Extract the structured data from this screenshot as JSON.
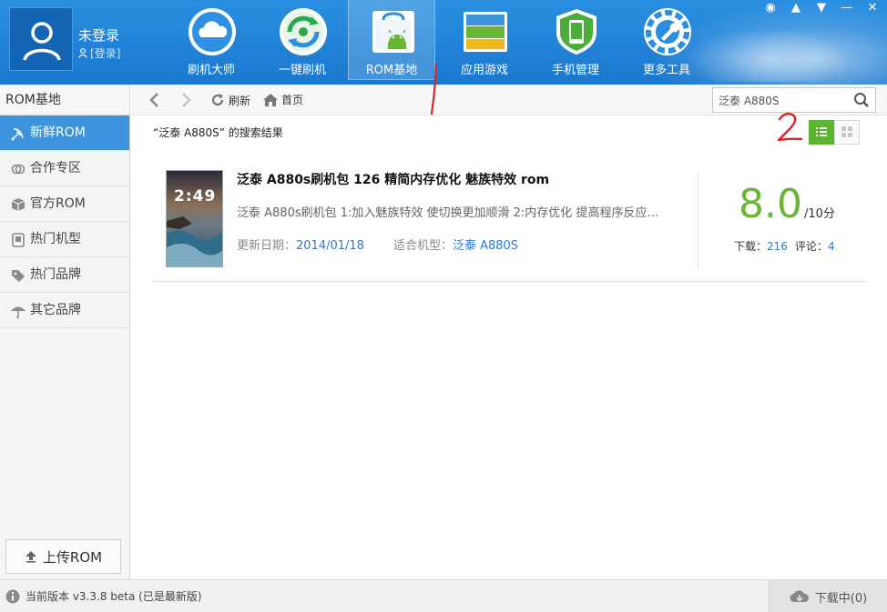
{
  "header": {
    "user": {
      "name": "未登录",
      "login_link": "[登录]"
    },
    "nav": [
      {
        "label": "刷机大师",
        "icon": "cloud-icon"
      },
      {
        "label": "一键刷机",
        "icon": "refresh-disc-icon"
      },
      {
        "label": "ROM基地",
        "icon": "android-bag-icon",
        "active": true
      },
      {
        "label": "应用游戏",
        "icon": "app-stack-icon"
      },
      {
        "label": "手机管理",
        "icon": "phone-shield-icon"
      },
      {
        "label": "更多工具",
        "icon": "wrench-icon"
      }
    ]
  },
  "sidebar": {
    "title": "ROM基地",
    "items": [
      {
        "label": "新鲜ROM",
        "icon": "satellite-icon",
        "active": true
      },
      {
        "label": "合作专区",
        "icon": "link-icon"
      },
      {
        "label": "官方ROM",
        "icon": "box-icon"
      },
      {
        "label": "热门机型",
        "icon": "phone-icon"
      },
      {
        "label": "热门品牌",
        "icon": "tag-icon"
      },
      {
        "label": "其它品牌",
        "icon": "umbrella-icon"
      }
    ],
    "upload_label": "上传ROM"
  },
  "toolbar": {
    "refresh_label": "刷新",
    "home_label": "首页",
    "search_value": "泛泰 A880S"
  },
  "content": {
    "result_title": "“泛泰 A880S” 的搜索结果",
    "annotations": [
      "1",
      "2"
    ],
    "roms": [
      {
        "thumb_time": "2:49",
        "name": "泛泰 A880s刷机包 126 精简内存优化 魅族特效 rom",
        "description": "泛泰 A880s刷机包 1:加入魅族特效 使切换更加顺滑 2:内存优化 提高程序反应速...",
        "update_label": "更新日期：",
        "update_date": "2014/01/18",
        "model_label": "适合机型：",
        "model": "泛泰 A880S",
        "score": "8.0",
        "score_suffix": "/10分",
        "downloads_label": "下载：",
        "downloads": "216",
        "comments_label": "评论：",
        "comments": "4"
      }
    ]
  },
  "statusbar": {
    "version": "当前版本 v3.3.8 beta (已是最新版)",
    "download_status": "下载中(0)"
  },
  "colors": {
    "header_blue": "#1a78cf",
    "active_blue": "#3d94dc",
    "score_green": "#6ab533",
    "link_blue": "#2a7ad3",
    "annotation_red": "#e02020"
  }
}
